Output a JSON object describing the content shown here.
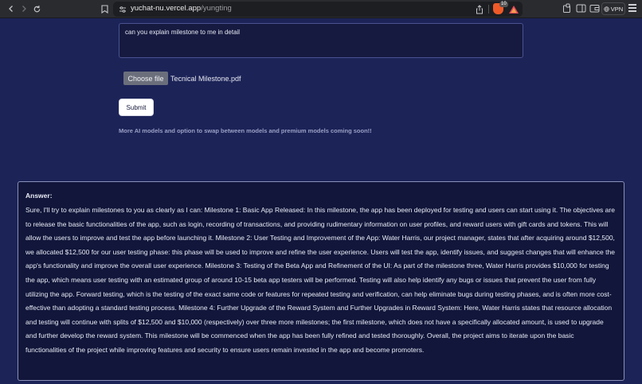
{
  "browser": {
    "url_domain": "yuchat-nu.vercel.app",
    "url_path": "/yungting",
    "shield_count": "10",
    "vpn_label": "VPN"
  },
  "prompt": {
    "value": "can you explain milestone to me in detail"
  },
  "file_input": {
    "button_label": "Choose file",
    "file_name": "Tecnical Milestone.pdf"
  },
  "submit_label": "Submit",
  "notice": "More AI models and option to swap between models and premium models coming soon!!",
  "answer": {
    "label": "Answer:",
    "text": "Sure, I'll try to explain milestones to you as clearly as I can: Milestone 1: Basic App Released: In this milestone, the app has been deployed for testing and users can start using it. The objectives are to release the basic functionalities of the app, such as login, recording of transactions, and providing rudimentary information on user profiles, and reward users with gift cards and tokens. This will allow the users to improve and test the app before launching it. Milestone 2: User Testing and Improvement of the App: Water Harris, our project manager, states that after acquiring around $12,500, we allocated $12,500 for our user testing phase: this phase will be used to improve and refine the user experience. Users will test the app, identify issues, and suggest changes that will enhance the app's functionality and improve the overall user experience. Milestone 3: Testing of the Beta App and Refinement of the UI: As part of the milestone three, Water Harris provides $10,000 for testing the app, which means user testing with an estimated group of around 10-15 beta app testers will be performed. Testing will also help identify any bugs or issues that prevent the user from fully utilizing the app. Forward testing, which is the testing of the exact same code or features for repeated testing and verification, can help eliminate bugs during testing phases, and is often more cost-effective than adopting a standard testing process. Milestone 4: Further Upgrade of the Reward System and Further Upgrades in Reward System: Here, Water Harris states that resource allocation and testing will continue with splits of $12,500 and $10,000 (respectively) over three more milestones; the first milestone, which does not have a specifically allocated amount, is used to upgrade and further develop the reward system. This milestone will be commenced when the app has been fully refined and tested thoroughly. Overall, the project aims to iterate upon the basic functionalities of the project while improving features and security to ensure users remain invested in the app and become promoters."
  },
  "icons": {
    "back": "back-arrow-icon",
    "forward": "forward-arrow-icon",
    "reload": "reload-icon",
    "bookmark": "bookmark-icon",
    "share": "share-icon",
    "shield": "brave-shield-icon",
    "rewards": "brave-rewards-icon"
  },
  "colors": {
    "page_bg": "#1c2357",
    "answer_bg": "#11163a",
    "chrome_bg": "#2a2b2f",
    "brave_orange": "#f05a28"
  }
}
